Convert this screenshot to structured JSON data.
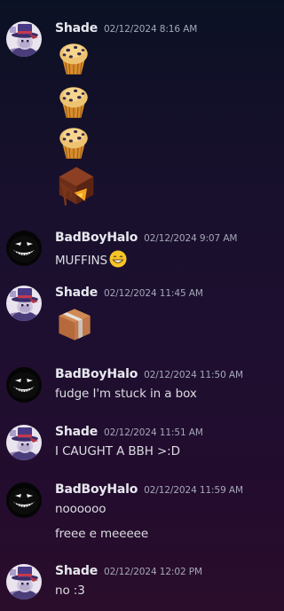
{
  "colors": {
    "background_top": "#0b1124",
    "background_bottom": "#2a0d2b",
    "author": "#e7e8ef",
    "timestamp": "#a5a8b8",
    "text": "#dcdde3"
  },
  "messages": [
    {
      "author": "Shade",
      "timestamp": "02/12/2024 8:16 AM",
      "avatar": "shade-avatar",
      "emojis": [
        "muffin-emoji",
        "muffin-emoji",
        "muffin-emoji",
        "chocolate-fudge-emoji"
      ]
    },
    {
      "author": "BadBoyHalo",
      "timestamp": "02/12/2024 9:07 AM",
      "avatar": "badboyhalo-avatar",
      "lines": [
        "MUFFINS"
      ],
      "inline_emoji": "grinning-emoji"
    },
    {
      "author": "Shade",
      "timestamp": "02/12/2024 11:45 AM",
      "avatar": "shade-avatar",
      "emojis": [
        "package-box-emoji"
      ]
    },
    {
      "author": "BadBoyHalo",
      "timestamp": "02/12/2024 11:50 AM",
      "avatar": "badboyhalo-avatar",
      "lines": [
        "fudge I'm stuck in a box"
      ]
    },
    {
      "author": "Shade",
      "timestamp": "02/12/2024 11:51 AM",
      "avatar": "shade-avatar",
      "lines": [
        "I CAUGHT A BBH >:D"
      ]
    },
    {
      "author": "BadBoyHalo",
      "timestamp": "02/12/2024 11:59 AM",
      "avatar": "badboyhalo-avatar",
      "lines": [
        "noooooo",
        "freee e meeeee"
      ]
    },
    {
      "author": "Shade",
      "timestamp": "02/12/2024 12:02 PM",
      "avatar": "shade-avatar",
      "lines": [
        "no :3"
      ]
    }
  ]
}
